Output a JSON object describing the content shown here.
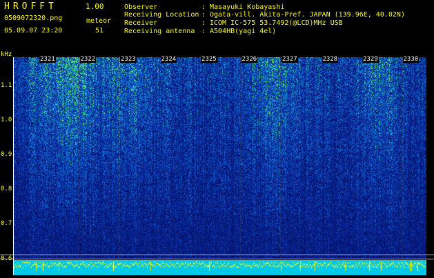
{
  "header": {
    "title": "HROFFT",
    "version": "1.00",
    "file_name": "0509072320.png",
    "meteor_label": "meteor",
    "datetime": "05.09.07 23:20",
    "meteor_count": "51"
  },
  "info": [
    {
      "key": "Observer",
      "value": "Masayuki Kobayashi"
    },
    {
      "key": "Receiving Location",
      "value": "Ogata-vill. Akita-Pref. JAPAN (139.96E, 40.02N)"
    },
    {
      "key": "Receiver",
      "value": "ICOM IC-575 53.7492(@LCD)MHz USB"
    },
    {
      "key": "Receiving antenna",
      "value": "A504HB(yagi 4el)"
    }
  ],
  "axis": {
    "y_unit": "kHz",
    "y_labels": [
      "1.1",
      "1.0",
      "0.9",
      "0.8",
      "0.7",
      "0.6"
    ],
    "x_labels": [
      "2321",
      "2322",
      "2323",
      "2324",
      "2325",
      "2326",
      "2327",
      "2328",
      "2329",
      "2330"
    ]
  },
  "colors": {
    "label": "#ffff00",
    "background": "#000000",
    "spectrogram_base": "#0a2a8c",
    "signal_strip": "#00c8e8"
  }
}
